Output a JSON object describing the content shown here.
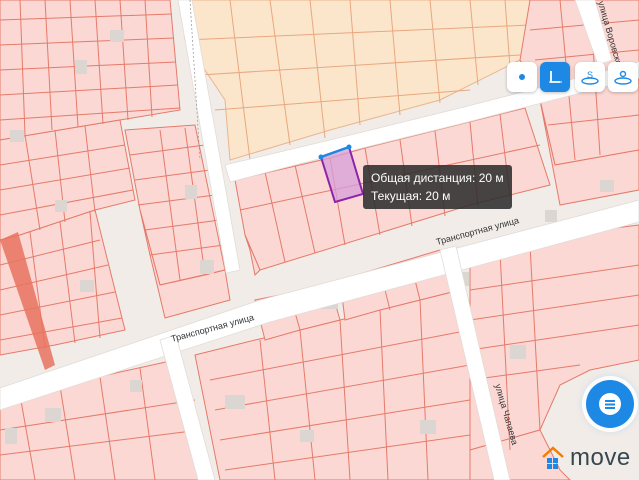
{
  "toolbar": {
    "items": [
      {
        "icon": "point-marker-icon",
        "label": "Точка"
      },
      {
        "icon": "distance-measure-icon",
        "label": "Расстояние",
        "active": true
      },
      {
        "icon": "area-measure-icon",
        "label": "Площадь"
      },
      {
        "icon": "radius-measure-icon",
        "label": "Радиус"
      }
    ]
  },
  "measurement": {
    "total_line": "Общая дистанция: 20 м",
    "current_line": "Текущая: 20 м"
  },
  "streets": {
    "transport_upper": "Транспортная улица",
    "transport_lower": "Транспортная улица",
    "vorovskogo": "улица Воровског",
    "chapaeva": "улица Чапаева"
  },
  "logo": {
    "text": "move"
  },
  "colors": {
    "accent": "#1e88e5",
    "parcel_fill": "#fbd7d3",
    "parcel_stroke": "#e57a6a",
    "highlight": "#8e24aa",
    "industrial": "#fbe7cf"
  }
}
